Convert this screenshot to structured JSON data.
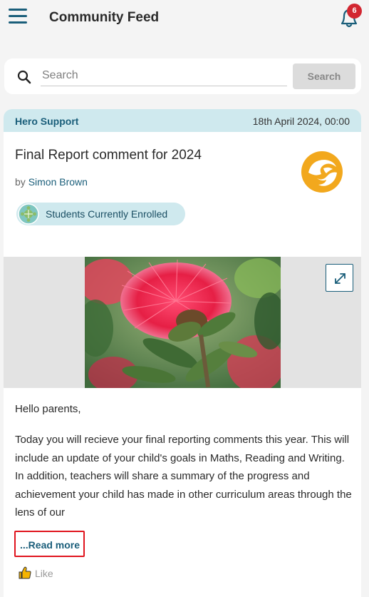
{
  "header": {
    "title": "Community Feed",
    "notification_count": "6"
  },
  "search": {
    "placeholder": "Search",
    "button_label": "Search"
  },
  "post": {
    "category": "Hero Support",
    "date": "18th April 2024, 00:00",
    "title": "Final Report comment for 2024",
    "author_prefix": "by",
    "author": "Simon Brown",
    "audience": "Students Currently Enrolled",
    "greeting": "Hello parents,",
    "body": "Today you will recieve your final reporting comments this year. This will include an update of your child's goals in Maths, Reading and Writing. In addition, teachers will share a summary of the progress and achievement your child has made in other curriculum areas through the lens of our",
    "read_more": "...Read more",
    "like_label": "Like"
  },
  "colors": {
    "brand": "#1a5e7a",
    "meta_background": "#cfe9ee",
    "badge": "#d22630",
    "logo": "#f2a81d",
    "highlight_border": "#e0141e"
  },
  "icons": {
    "menu": "hamburger-icon",
    "notifications": "bell-icon",
    "search": "search-icon",
    "school_logo": "school-logo",
    "audience": "group-icon",
    "expand": "expand-icon",
    "like": "thumbs-up-icon"
  }
}
